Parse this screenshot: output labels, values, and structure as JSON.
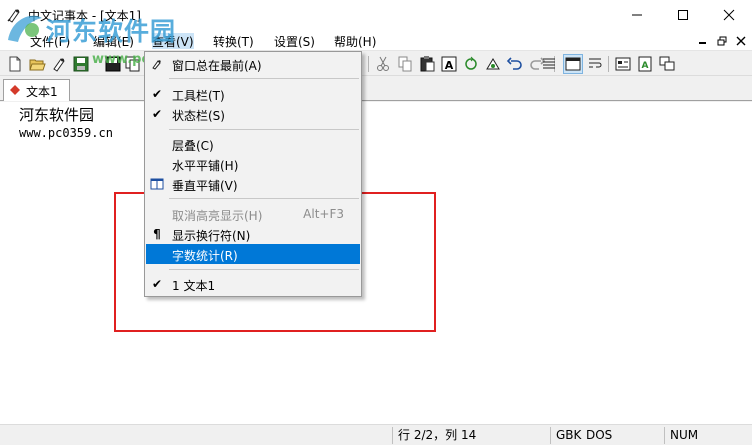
{
  "window": {
    "title": "中文记事本 - [文本1]"
  },
  "watermark": {
    "text": "河东软件园",
    "url": "www.pc0359.cn"
  },
  "menubar": {
    "items": [
      {
        "label": "文件(F)"
      },
      {
        "label": "编辑(E)"
      },
      {
        "label": "查看(V)"
      },
      {
        "label": "转换(T)"
      },
      {
        "label": "设置(S)"
      },
      {
        "label": "帮助(H)"
      }
    ]
  },
  "tabs": [
    {
      "label": "文本1"
    }
  ],
  "editor": {
    "lines": [
      "河东软件园",
      "www.pc0359.cn"
    ]
  },
  "view_menu": {
    "items": [
      {
        "label": "窗口总在最前(A)",
        "icon": "pin-icon"
      },
      {
        "label": "工具栏(T)",
        "checked": true
      },
      {
        "label": "状态栏(S)",
        "checked": true
      },
      {
        "label": "层叠(C)"
      },
      {
        "label": "水平平铺(H)"
      },
      {
        "label": "垂直平铺(V)",
        "icon": "tile-vertical-icon"
      },
      {
        "label": "取消高亮显示(H)",
        "shortcut": "Alt+F3",
        "disabled": true
      },
      {
        "label": "显示换行符(N)",
        "icon": "pilcrow-icon",
        "glyph": "¶"
      },
      {
        "label": "字数统计(R)",
        "highlighted": true
      },
      {
        "label": "1 文本1",
        "checked": true
      }
    ],
    "check_glyph": "✔"
  },
  "statusbar": {
    "position": "行 2/2，列 14",
    "encoding": "GBK",
    "line_ending": "DOS",
    "numlock": "NUM"
  },
  "colors": {
    "menu_highlight": "#0078d7",
    "annotation_red": "#e02020",
    "watermark_blue": "#3b9fd6",
    "watermark_green": "#4fb24f"
  }
}
